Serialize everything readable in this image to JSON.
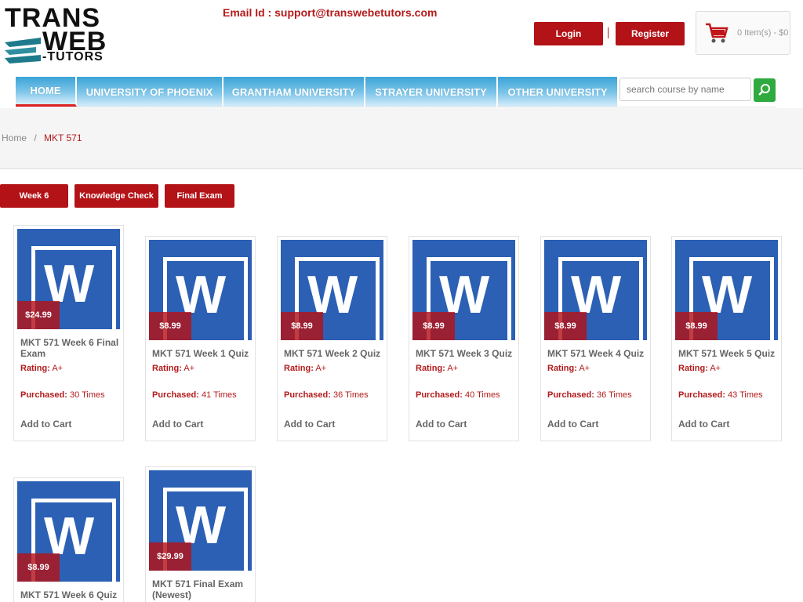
{
  "header": {
    "logo": {
      "line1": "TRANS",
      "line2": "WEB",
      "line3": "-TUTORS"
    },
    "email": "Email Id : support@transwebetutors.com",
    "login_label": "Login",
    "register_label": "Register",
    "cart_text": "0 Item(s) - $0"
  },
  "nav": {
    "items": [
      {
        "label": "HOME"
      },
      {
        "label": "UNIVERSITY OF PHOENIX"
      },
      {
        "label": "GRANTHAM UNIVERSITY"
      },
      {
        "label": "STRAYER UNIVERSITY"
      },
      {
        "label": "OTHER UNIVERSITY"
      }
    ],
    "search_placeholder": "search course by name"
  },
  "breadcrumb": {
    "home": "Home",
    "separator": "/",
    "current": "MKT 571"
  },
  "filters": [
    "Week 6",
    "Knowledge Check",
    "Final Exam"
  ],
  "card_labels": {
    "rating": "Rating:",
    "purchased": "Purchased:",
    "add_to_cart": "Add to Cart"
  },
  "products": [
    {
      "title": "MKT 571 Week 6 Final Exam",
      "price": "$24.99",
      "rating": "A+",
      "purchased": "30 Times"
    },
    {
      "title": "MKT 571 Week 1 Quiz",
      "price": "$8.99",
      "rating": "A+",
      "purchased": "41 Times"
    },
    {
      "title": "MKT 571 Week 2 Quiz",
      "price": "$8.99",
      "rating": "A+",
      "purchased": "36 Times"
    },
    {
      "title": "MKT 571 Week 3 Quiz",
      "price": "$8.99",
      "rating": "A+",
      "purchased": "40 Times"
    },
    {
      "title": "MKT 571 Week 4 Quiz",
      "price": "$8.99",
      "rating": "A+",
      "purchased": "36 Times"
    },
    {
      "title": "MKT 571 Week 5 Quiz",
      "price": "$8.99",
      "rating": "A+",
      "purchased": "43 Times"
    },
    {
      "title": "MKT 571 Week 6 Quiz",
      "price": "$8.99",
      "rating": "",
      "purchased": ""
    },
    {
      "title": "MKT 571 Final Exam (Newest)",
      "price": "$29.99",
      "rating": "",
      "purchased": ""
    }
  ],
  "colors": {
    "brand_red": "#b31217",
    "nav_blue": "#3aa3d6",
    "word_blue": "#2b60b4",
    "search_green": "#2eaa3e"
  },
  "icons": {
    "cart": "shopping-cart-icon",
    "search": "magnifier-icon",
    "product": "word-document-icon"
  }
}
